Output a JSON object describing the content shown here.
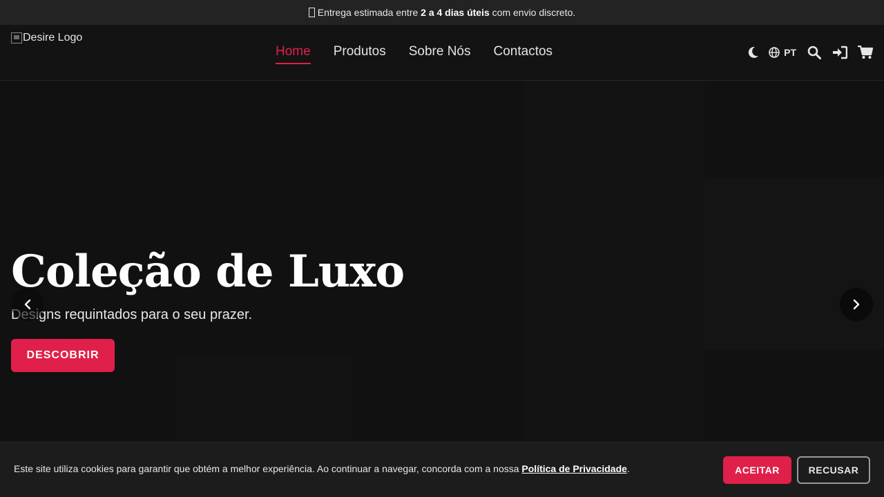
{
  "announcement": {
    "before": "Entrega estimada entre ",
    "bold": "2 a 4 dias úteis",
    "after": " com envio discreto.",
    "icon": "truck-icon"
  },
  "header": {
    "logo_alt": "Desire Logo",
    "nav": [
      {
        "label": "Home",
        "active": true
      },
      {
        "label": "Produtos",
        "active": false
      },
      {
        "label": "Sobre Nós",
        "active": false
      },
      {
        "label": "Contactos",
        "active": false
      }
    ],
    "language": "PT",
    "accent_color": "#e0204a"
  },
  "hero": {
    "title": "Coleção de Luxo",
    "subtitle": "Designs requintados para o seu prazer.",
    "cta": "DESCOBRIR"
  },
  "cookie_banner": {
    "text": "Este site utiliza cookies para garantir que obtém a melhor experiência. Ao continuar a navegar, concorda com a nossa ",
    "link": "Política de Privacidade",
    "end": ".",
    "accept": "ACEITAR",
    "refuse": "RECUSAR"
  }
}
